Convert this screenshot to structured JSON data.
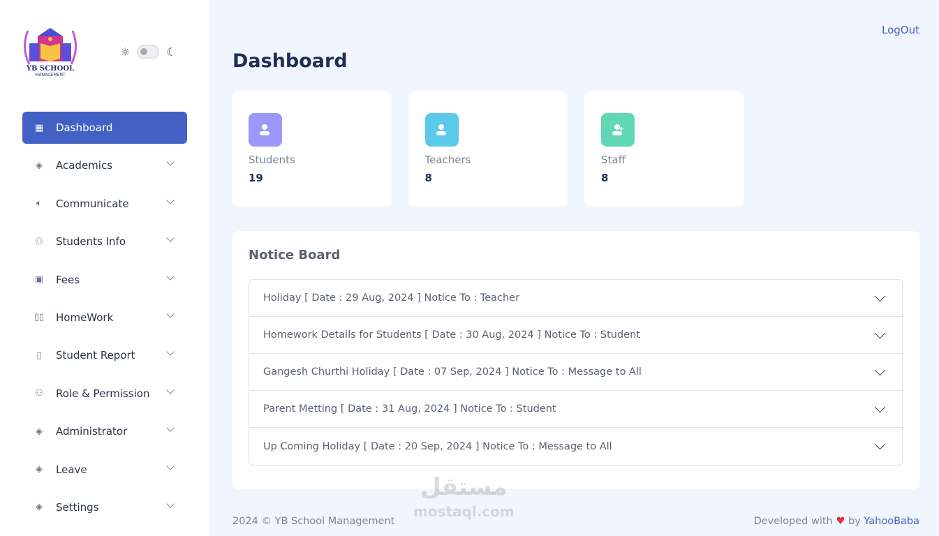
{
  "logo": {
    "text": "YB SCHOOL",
    "subtext": "MANAGEMENT"
  },
  "theme": {
    "light_icon": "sun-icon",
    "dark_icon": "moon-icon",
    "dark_mode": false
  },
  "sidebar": {
    "items": [
      {
        "label": "Dashboard",
        "icon": "grid-icon",
        "active": true
      },
      {
        "label": "Academics",
        "icon": "layers-icon"
      },
      {
        "label": "Communicate",
        "icon": "speaker-icon"
      },
      {
        "label": "Students Info",
        "icon": "users-icon"
      },
      {
        "label": "Fees",
        "icon": "money-icon"
      },
      {
        "label": "HomeWork",
        "icon": "book-icon"
      },
      {
        "label": "Student Report",
        "icon": "tablet-icon"
      },
      {
        "label": "Role & Permission",
        "icon": "users-icon"
      },
      {
        "label": "Administrator",
        "icon": "layers-icon"
      },
      {
        "label": "Leave",
        "icon": "layers-icon"
      },
      {
        "label": "Settings",
        "icon": "layers-icon"
      }
    ]
  },
  "header": {
    "logout": "LogOut",
    "title": "Dashboard"
  },
  "cards": [
    {
      "label": "Students",
      "value": "19",
      "color": "#9b97fb",
      "icon": "user-icon"
    },
    {
      "label": "Teachers",
      "value": "8",
      "color": "#5bc9ea",
      "icon": "user-icon"
    },
    {
      "label": "Staff",
      "value": "8",
      "color": "#5fd8b3",
      "icon": "user-plus-icon"
    }
  ],
  "notice": {
    "title": "Notice Board",
    "items": [
      "Holiday [ Date : 29 Aug, 2024 ] Notice To : Teacher",
      "Homework Details for Students [ Date : 30 Aug, 2024 ] Notice To : Student",
      "Gangesh Churthi Holiday [ Date : 07 Sep, 2024 ] Notice To : Message to All",
      "Parent Metting [ Date : 31 Aug, 2024 ] Notice To : Student",
      "Up Coming Holiday [ Date : 20 Sep, 2024 ] Notice To : Message to All"
    ]
  },
  "footer": {
    "copyright": "2024 © YB School Management",
    "dev_prefix": "Developed with",
    "dev_by": "by",
    "dev_name": "YahooBaba"
  },
  "watermark": {
    "arabic": "مستقل",
    "latin": "mostaql.com"
  }
}
